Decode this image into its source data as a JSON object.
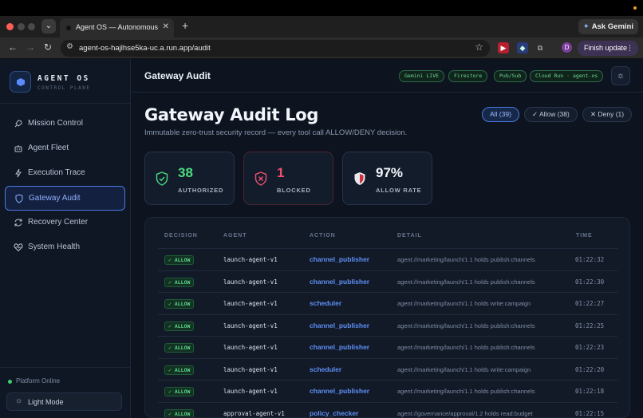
{
  "browser": {
    "tab_title": "Agent OS — Autonomous Ope",
    "url": "agent-os-hajlhse5ka-uc.a.run.app/audit",
    "ask_label": "Ask Gemini",
    "profile_initial": "D",
    "finish_label": "Finish update"
  },
  "sidebar": {
    "brand_name": "AGENT OS",
    "brand_sub": "CONTROL PLANE",
    "items": [
      {
        "label": "Mission Control",
        "icon": "rocket-icon"
      },
      {
        "label": "Agent Fleet",
        "icon": "robot-icon"
      },
      {
        "label": "Execution Trace",
        "icon": "bolt-icon"
      },
      {
        "label": "Gateway Audit",
        "icon": "shield-icon"
      },
      {
        "label": "Recovery Center",
        "icon": "refresh-icon"
      },
      {
        "label": "System Health",
        "icon": "heartbeat-icon"
      }
    ],
    "status": "Platform Online",
    "light_mode": "Light Mode"
  },
  "topbar": {
    "title": "Gateway Audit",
    "pills": [
      "Gemini LIVE",
      "Firestore",
      "Pub/Sub",
      "Cloud Run · agent-os"
    ]
  },
  "page": {
    "title": "Gateway Audit Log",
    "subtitle": "Immutable zero-trust security record — every tool call ALLOW/DENY decision.",
    "filters": [
      "All (39)",
      "✓ Allow (38)",
      "✕ Deny (1)"
    ]
  },
  "stats": [
    {
      "value": "38",
      "label": "AUTHORIZED",
      "color": "#4ade80"
    },
    {
      "value": "1",
      "label": "BLOCKED",
      "color": "#f0506e"
    },
    {
      "value": "97%",
      "label": "ALLOW RATE",
      "color": "#f2f5fa"
    }
  ],
  "table": {
    "headers": [
      "DECISION",
      "AGENT",
      "ACTION",
      "DETAIL",
      "TIME"
    ],
    "rows": [
      {
        "decision": "✓ ALLOW",
        "agent": "launch-agent-v1",
        "action": "channel_publisher",
        "detail": "agent://marketing/launch/1.1 holds publish:channels",
        "time": "01:22:32"
      },
      {
        "decision": "✓ ALLOW",
        "agent": "launch-agent-v1",
        "action": "channel_publisher",
        "detail": "agent://marketing/launch/1.1 holds publish:channels",
        "time": "01:22:30"
      },
      {
        "decision": "✓ ALLOW",
        "agent": "launch-agent-v1",
        "action": "scheduler",
        "detail": "agent://marketing/launch/1.1 holds write:campaign",
        "time": "01:22:27"
      },
      {
        "decision": "✓ ALLOW",
        "agent": "launch-agent-v1",
        "action": "channel_publisher",
        "detail": "agent://marketing/launch/1.1 holds publish:channels",
        "time": "01:22:25"
      },
      {
        "decision": "✓ ALLOW",
        "agent": "launch-agent-v1",
        "action": "channel_publisher",
        "detail": "agent://marketing/launch/1.1 holds publish:channels",
        "time": "01:22:23"
      },
      {
        "decision": "✓ ALLOW",
        "agent": "launch-agent-v1",
        "action": "scheduler",
        "detail": "agent://marketing/launch/1.1 holds write:campaign",
        "time": "01:22:20"
      },
      {
        "decision": "✓ ALLOW",
        "agent": "launch-agent-v1",
        "action": "channel_publisher",
        "detail": "agent://marketing/launch/1.1 holds publish:channels",
        "time": "01:22:18"
      },
      {
        "decision": "✓ ALLOW",
        "agent": "approval-agent-v1",
        "action": "policy_checker",
        "detail": "agent://governance/approval/1.2 holds read:budget",
        "time": "01:22:15"
      }
    ]
  }
}
